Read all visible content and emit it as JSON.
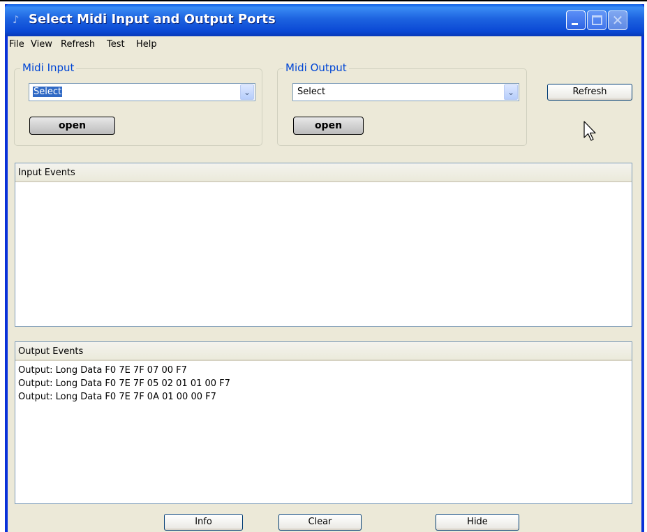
{
  "window": {
    "title": "Select Midi Input and Output Ports"
  },
  "menubar": {
    "items": [
      "File",
      "View",
      "Refresh",
      "Test",
      "Help"
    ]
  },
  "midi_input": {
    "legend": "Midi Input",
    "selected": "Select",
    "open_label": "open"
  },
  "midi_output": {
    "legend": "Midi Output",
    "selected": "Select",
    "open_label": "open"
  },
  "refresh_label": "Refresh",
  "input_events": {
    "header": "Input Events",
    "lines": []
  },
  "output_events": {
    "header": "Output Events",
    "lines": [
      "Output: Long Data F0 7E 7F 07 00 F7",
      "Output: Long Data F0 7E 7F 05 02 01 01 00 F7",
      "Output: Long Data F0 7E 7F 0A 01 00 00 F7"
    ]
  },
  "buttons": {
    "info": "Info",
    "clear": "Clear",
    "hide": "Hide"
  },
  "icons": {
    "app": "midi-app-icon",
    "dropdown": "chevron-down-icon",
    "cursor": "mouse-pointer-icon"
  },
  "colors": {
    "titlebar": "#0a48d4",
    "legend_text": "#0046d5",
    "selection": "#316ac5",
    "window_bg": "#ece9d8"
  }
}
